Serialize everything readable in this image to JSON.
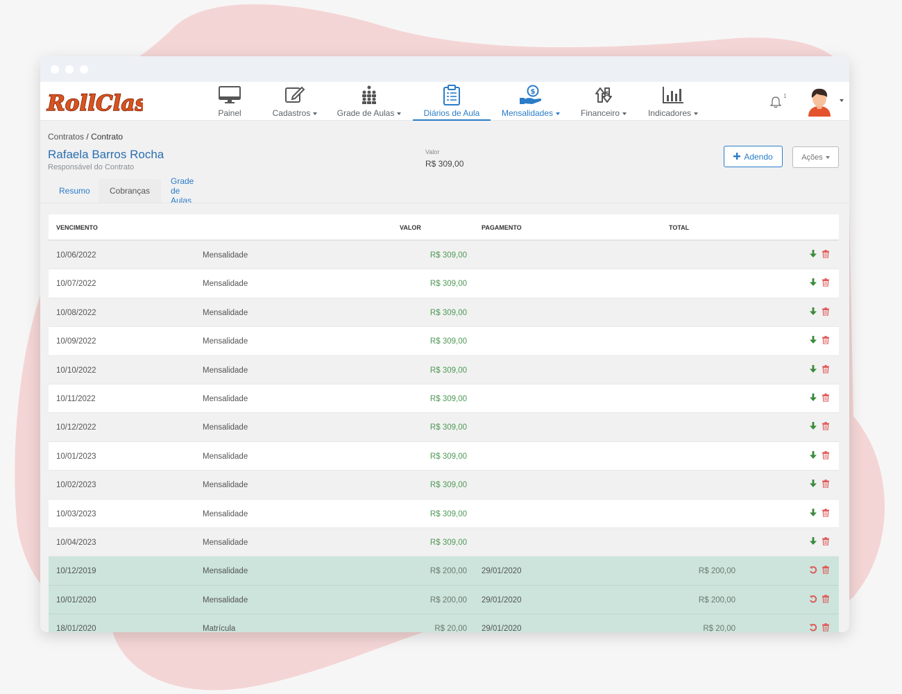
{
  "app": {
    "logo_text": "RollClass",
    "colors": {
      "accent": "#2a7cc7",
      "logo": "#d9531e",
      "paid_row": "#cce4dc",
      "value_green": "#4e9a54",
      "delete_red": "#e05a5a"
    }
  },
  "nav": {
    "items": [
      {
        "label": "Painel",
        "icon": "monitor-icon",
        "dropdown": false
      },
      {
        "label": "Cadastros",
        "icon": "edit-icon",
        "dropdown": true
      },
      {
        "label": "Grade de Aulas",
        "icon": "people-grid-icon",
        "dropdown": true
      },
      {
        "label": "Diários de Aula",
        "icon": "clipboard-icon",
        "dropdown": false,
        "active": true
      },
      {
        "label": "Mensalidades",
        "icon": "money-hand-icon",
        "dropdown": true
      },
      {
        "label": "Financeiro",
        "icon": "finance-icon",
        "dropdown": true
      },
      {
        "label": "Indicadores",
        "icon": "bar-chart-icon",
        "dropdown": true
      }
    ],
    "notification_count": "1"
  },
  "header": {
    "breadcrumb_parent": "Contratos",
    "breadcrumb_sep": "/",
    "breadcrumb_current": "Contrato",
    "person_name": "Rafaela Barros Rocha",
    "person_role": "Responsável do Contrato",
    "valor_label": "Valor",
    "valor_value": "R$ 309,00",
    "adendo_label": "Adendo",
    "acoes_label": "Ações"
  },
  "tabs": [
    {
      "label": "Resumo",
      "active": false
    },
    {
      "label": "Cobranças",
      "active": true
    },
    {
      "label": "Grade de Aulas",
      "active": false
    }
  ],
  "table": {
    "columns": {
      "vencimento": "VENCIMENTO",
      "valor": "VALOR",
      "pagamento": "PAGAMENTO",
      "total": "TOTAL"
    },
    "rows": [
      {
        "vencimento": "10/06/2022",
        "descricao": "Mensalidade",
        "valor": "R$ 309,00",
        "pagamento": "",
        "total": "",
        "paid": false
      },
      {
        "vencimento": "10/07/2022",
        "descricao": "Mensalidade",
        "valor": "R$ 309,00",
        "pagamento": "",
        "total": "",
        "paid": false
      },
      {
        "vencimento": "10/08/2022",
        "descricao": "Mensalidade",
        "valor": "R$ 309,00",
        "pagamento": "",
        "total": "",
        "paid": false
      },
      {
        "vencimento": "10/09/2022",
        "descricao": "Mensalidade",
        "valor": "R$ 309,00",
        "pagamento": "",
        "total": "",
        "paid": false
      },
      {
        "vencimento": "10/10/2022",
        "descricao": "Mensalidade",
        "valor": "R$ 309,00",
        "pagamento": "",
        "total": "",
        "paid": false
      },
      {
        "vencimento": "10/11/2022",
        "descricao": "Mensalidade",
        "valor": "R$ 309,00",
        "pagamento": "",
        "total": "",
        "paid": false
      },
      {
        "vencimento": "10/12/2022",
        "descricao": "Mensalidade",
        "valor": "R$ 309,00",
        "pagamento": "",
        "total": "",
        "paid": false
      },
      {
        "vencimento": "10/01/2023",
        "descricao": "Mensalidade",
        "valor": "R$ 309,00",
        "pagamento": "",
        "total": "",
        "paid": false
      },
      {
        "vencimento": "10/02/2023",
        "descricao": "Mensalidade",
        "valor": "R$ 309,00",
        "pagamento": "",
        "total": "",
        "paid": false
      },
      {
        "vencimento": "10/03/2023",
        "descricao": "Mensalidade",
        "valor": "R$ 309,00",
        "pagamento": "",
        "total": "",
        "paid": false
      },
      {
        "vencimento": "10/04/2023",
        "descricao": "Mensalidade",
        "valor": "R$ 309,00",
        "pagamento": "",
        "total": "",
        "paid": false
      },
      {
        "vencimento": "10/12/2019",
        "descricao": "Mensalidade",
        "valor": "R$ 200,00",
        "pagamento": "29/01/2020",
        "total": "R$ 200,00",
        "paid": true
      },
      {
        "vencimento": "10/01/2020",
        "descricao": "Mensalidade",
        "valor": "R$ 200,00",
        "pagamento": "29/01/2020",
        "total": "R$ 200,00",
        "paid": true
      },
      {
        "vencimento": "18/01/2020",
        "descricao": "Matrícula",
        "valor": "R$ 20,00",
        "pagamento": "29/01/2020",
        "total": "R$ 20,00",
        "paid": true
      }
    ]
  }
}
